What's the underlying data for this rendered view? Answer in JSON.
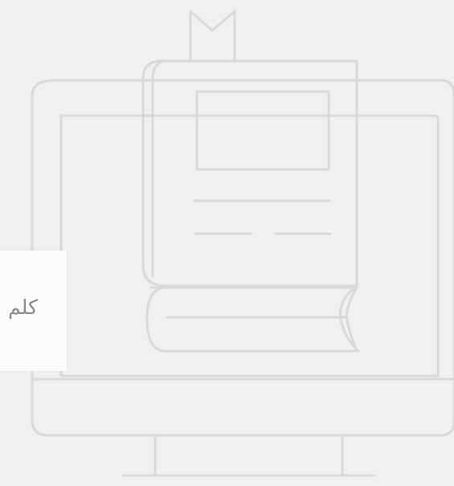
{
  "illustration": {
    "name": "computer-book-illustration",
    "stroke_color": "#d7d7d7",
    "background_color": "#f0f0f0"
  },
  "search_card": {
    "text": "كلم"
  }
}
